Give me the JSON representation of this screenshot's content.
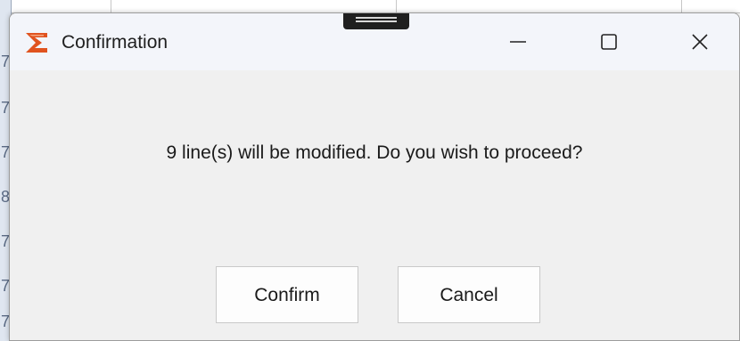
{
  "dialog": {
    "title": "Confirmation",
    "message": "9 line(s) will be modified. Do you wish to proceed?",
    "buttons": {
      "confirm_label": "Confirm",
      "cancel_label": "Cancel"
    },
    "window_controls": {
      "minimize_icon": "minimize-icon",
      "maximize_icon": "maximize-icon",
      "close_icon": "close-icon"
    },
    "app_icon": "app-logo-icon"
  },
  "colors": {
    "dialog_background": "#f0f0f0",
    "titlebar_background": "#f3f5fa",
    "app_icon_accent": "#e0531f",
    "button_border": "#c9c9c9"
  }
}
